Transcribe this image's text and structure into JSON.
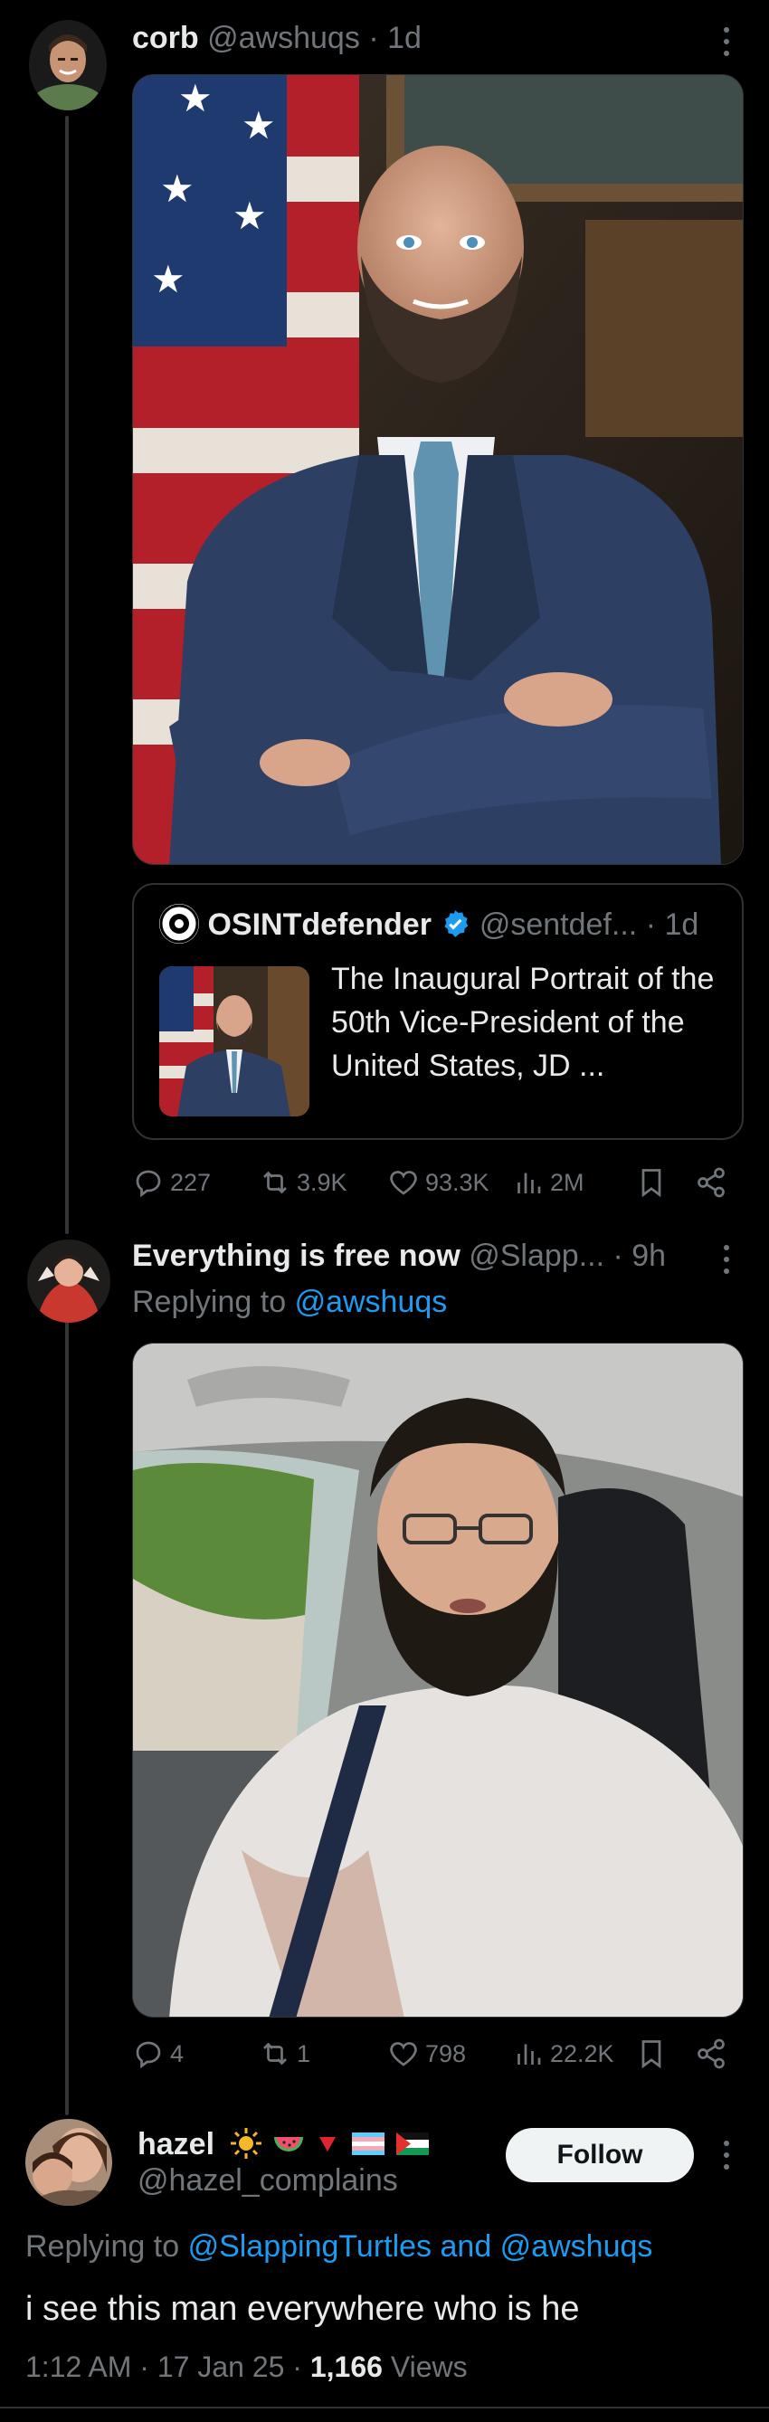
{
  "post1": {
    "name": "corb",
    "handle": "@awshuqs",
    "time": "· 1d",
    "quote": {
      "name": "OSINTdefender",
      "handle": "@sentdef...",
      "time": "· 1d",
      "text": "The Inaugural Portrait of the 50th Vice-President of the United States, JD ..."
    },
    "actions": {
      "replies": "227",
      "reposts": "3.9K",
      "likes": "93.3K",
      "views": "2M"
    }
  },
  "post2": {
    "name": "Everything is free now",
    "handle": "@Slapp...",
    "time": "· 9h",
    "replying_label": "Replying to",
    "replying_to": "@awshuqs",
    "actions": {
      "replies": "4",
      "reposts": "1",
      "likes": "798",
      "views": "22.2K"
    }
  },
  "post3": {
    "name": "hazel",
    "handle": "@hazel_complains",
    "follow_label": "Follow",
    "replying_label": "Replying to",
    "replying_to": "@SlappingTurtles and @awshuqs",
    "text": "i see this man everywhere who is he",
    "time": "1:12 AM · 17 Jan 25 · ",
    "views_count": "1,166",
    "views_label": " Views"
  },
  "colors": {
    "background": "#000000",
    "text": "#e7e9ea",
    "muted": "#71767b",
    "link": "#1d9bf0",
    "verified": "#1d9bf0",
    "border": "#2f3336"
  },
  "icons": [
    "more-icon",
    "verified-icon",
    "reply-icon",
    "repost-icon",
    "like-icon",
    "views-icon",
    "bookmark-icon",
    "share-icon",
    "sun-emoji-icon",
    "watermelon-emoji-icon",
    "red-triangle-icon",
    "trans-flag-icon",
    "palestine-flag-icon"
  ]
}
